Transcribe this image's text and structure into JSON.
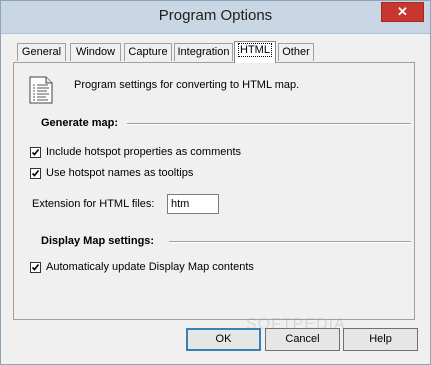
{
  "window": {
    "title": "Program Options",
    "close_glyph": "✕"
  },
  "tabs": [
    {
      "label": "General",
      "active": false
    },
    {
      "label": "Window",
      "active": false
    },
    {
      "label": "Capture",
      "active": false
    },
    {
      "label": "Integration",
      "active": false
    },
    {
      "label": "HTML",
      "active": true
    },
    {
      "label": "Other",
      "active": false
    }
  ],
  "panel": {
    "description": "Program settings for converting to HTML map.",
    "generate_map": {
      "heading": "Generate map:",
      "include_hotspot": {
        "label": "Include hotspot properties as comments",
        "checked": true
      },
      "use_hotspot_names": {
        "label": "Use hotspot names as tooltips",
        "checked": true
      },
      "extension_label": "Extension for HTML files:",
      "extension_value": "htm"
    },
    "display_map": {
      "heading": "Display Map settings:",
      "auto_update": {
        "label": "Automaticaly update Display Map contents",
        "checked": true
      }
    },
    "watermark": "SOFTPEDIA"
  },
  "buttons": {
    "ok": "OK",
    "cancel": "Cancel",
    "help": "Help"
  },
  "icons": {
    "document": "document-list-icon",
    "check": "checkmark-icon",
    "close": "close-icon"
  }
}
